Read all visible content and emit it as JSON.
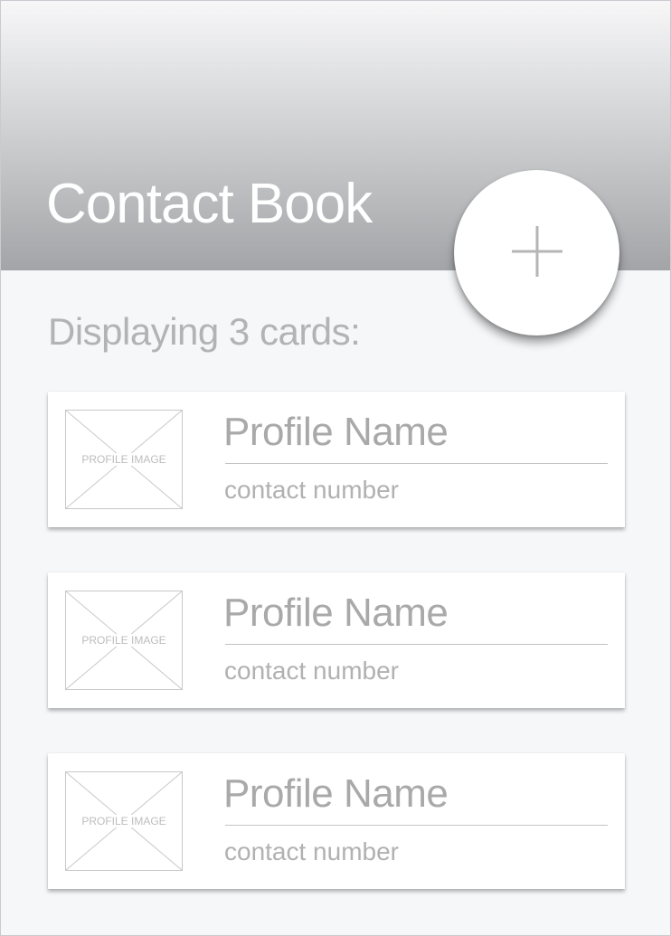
{
  "header": {
    "title": "Contact Book",
    "add_icon": "plus-icon"
  },
  "summary": {
    "text": "Displaying 3 cards:"
  },
  "cards": [
    {
      "image_label": "PROFILE IMAGE",
      "name": "Profile Name",
      "number": "contact number"
    },
    {
      "image_label": "PROFILE IMAGE",
      "name": "Profile Name",
      "number": "contact number"
    },
    {
      "image_label": "PROFILE IMAGE",
      "name": "Profile Name",
      "number": "contact number"
    }
  ],
  "colors": {
    "header_top": "#f7f7f8",
    "header_bottom": "#a3a4a7",
    "background": "#f6f7f9",
    "text_muted": "#b3b3b3"
  }
}
